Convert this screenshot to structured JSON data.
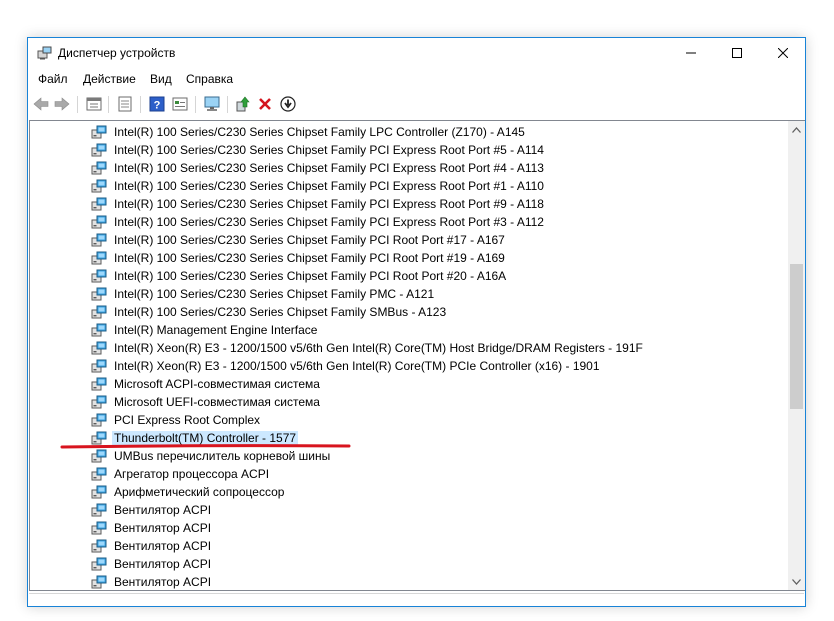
{
  "window": {
    "title": "Диспетчер устройств",
    "buttons": {
      "minimize": "minimize",
      "maximize": "maximize",
      "close": "close"
    }
  },
  "menu": [
    "Файл",
    "Действие",
    "Вид",
    "Справка"
  ],
  "toolbar": {
    "icons": [
      "back-icon",
      "forward-icon",
      "properties-view-icon",
      "device-list-icon",
      "help-icon",
      "view-resources-icon",
      "scan-hardware-icon",
      "update-driver-icon",
      "uninstall-icon",
      "disable-device-icon"
    ]
  },
  "devices": [
    "Intel(R) 100 Series/C230 Series Chipset Family LPC Controller (Z170) - A145",
    "Intel(R) 100 Series/C230 Series Chipset Family PCI Express Root Port #5 - A114",
    "Intel(R) 100 Series/C230 Series Chipset Family PCI Express Root Port #4 - A113",
    "Intel(R) 100 Series/C230 Series Chipset Family PCI Express Root Port #1 - A110",
    "Intel(R) 100 Series/C230 Series Chipset Family PCI Express Root Port #9 - A118",
    "Intel(R) 100 Series/C230 Series Chipset Family PCI Express Root Port #3 - A112",
    "Intel(R) 100 Series/C230 Series Chipset Family PCI Root Port #17 - A167",
    "Intel(R) 100 Series/C230 Series Chipset Family PCI Root Port #19 - A169",
    "Intel(R) 100 Series/C230 Series Chipset Family PCI Root Port #20 - A16A",
    "Intel(R) 100 Series/C230 Series Chipset Family PMC - A121",
    "Intel(R) 100 Series/C230 Series Chipset Family SMBus - A123",
    "Intel(R) Management Engine Interface",
    "Intel(R) Xeon(R) E3 - 1200/1500 v5/6th Gen Intel(R) Core(TM) Host Bridge/DRAM Registers - 191F",
    "Intel(R) Xeon(R) E3 - 1200/1500 v5/6th Gen Intel(R) Core(TM) PCIe Controller (x16) - 1901",
    "Microsoft ACPI-совместимая система",
    "Microsoft UEFI-совместимая система",
    "PCI Express Root Complex",
    "Thunderbolt(TM) Controller - 1577",
    "UMBus перечислитель корневой шины",
    "Агрегатор процессора ACPI",
    "Арифметический сопроцессор",
    "Вентилятор ACPI",
    "Вентилятор ACPI",
    "Вентилятор ACPI",
    "Вентилятор ACPI",
    "Вентилятор ACPI"
  ],
  "selected_device": "Thunderbolt(TM) Controller - 1577",
  "colors": {
    "selection": "#cce8ff",
    "annotation": "#d8141e",
    "border": "#1883d7"
  }
}
